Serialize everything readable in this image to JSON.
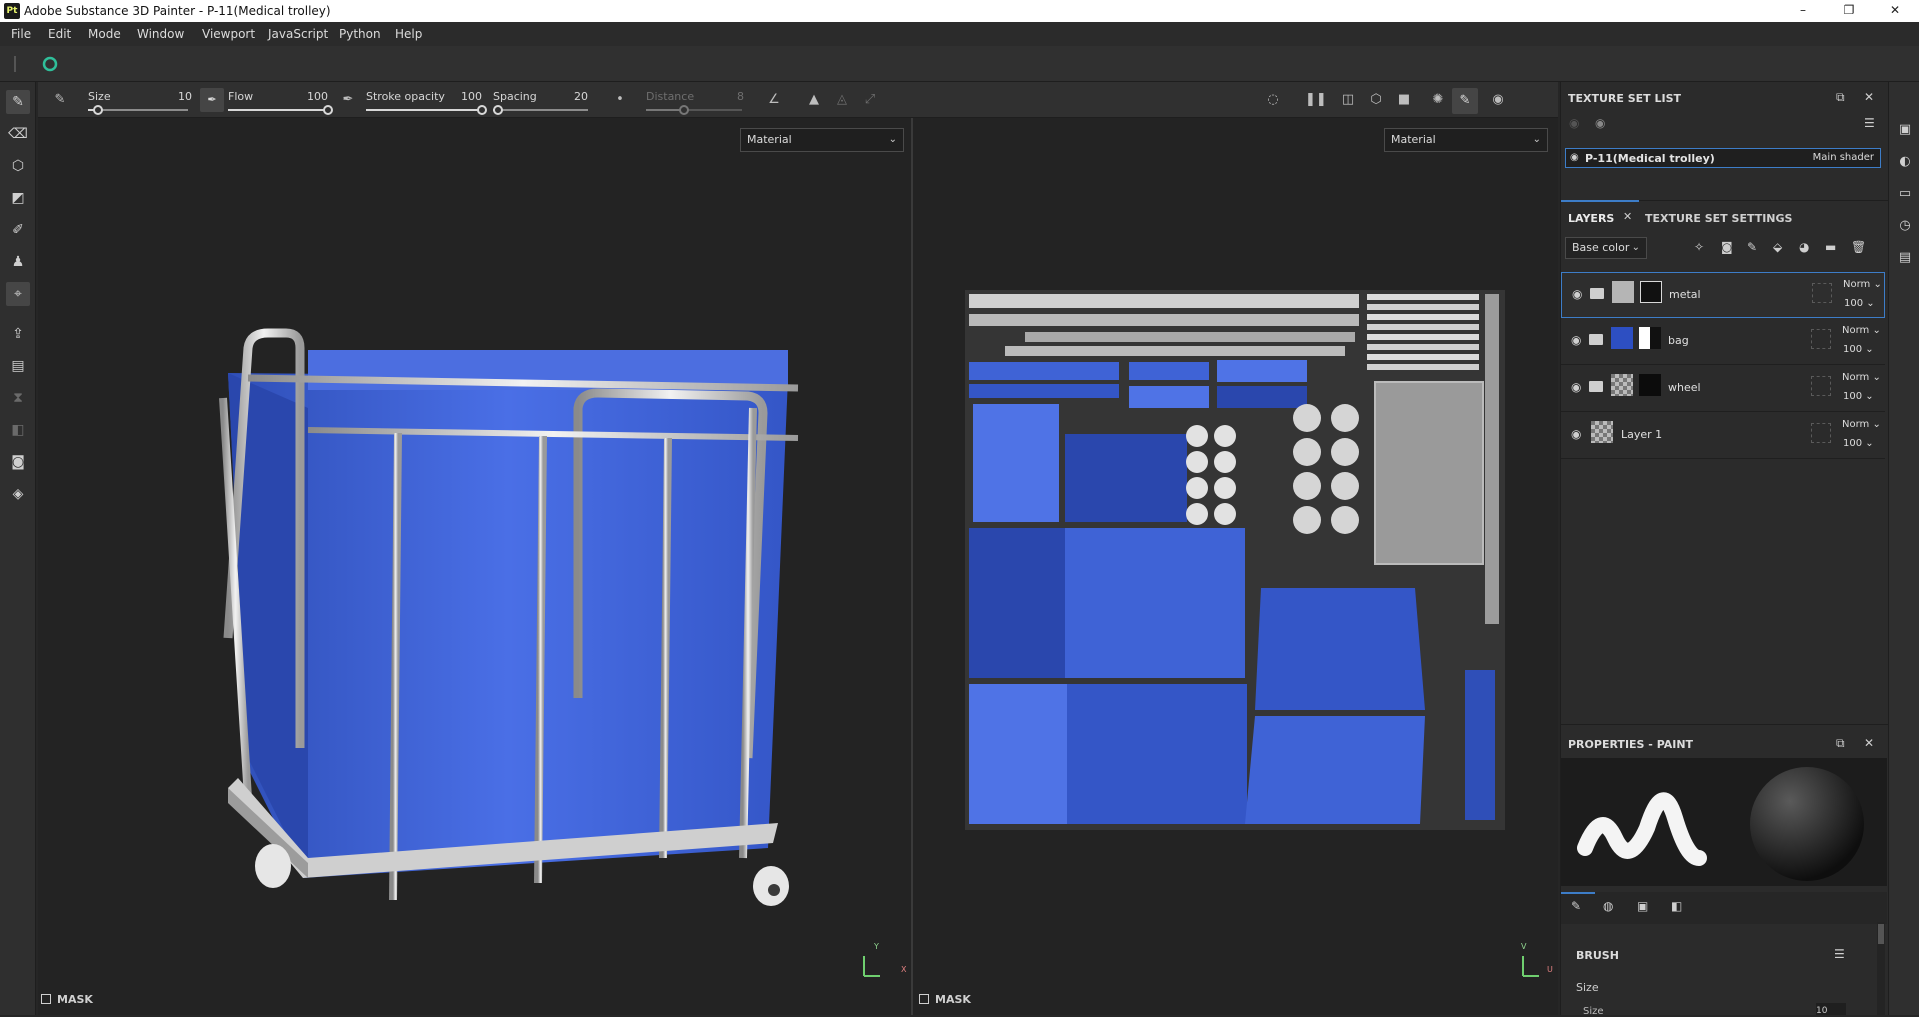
{
  "window": {
    "title": "Adobe Substance 3D Painter - P-11(Medical trolley)",
    "app_badge": "Pt",
    "minimize": "–",
    "maximize": "❐",
    "close": "✕"
  },
  "menu": [
    "File",
    "Edit",
    "Mode",
    "Window",
    "Viewport",
    "JavaScript",
    "Python",
    "Help"
  ],
  "toolbar": {
    "size": {
      "label": "Size",
      "value": "10",
      "fraction": 0.1
    },
    "flow": {
      "label": "Flow",
      "value": "100",
      "fraction": 1.0
    },
    "stroke_opacity": {
      "label": "Stroke opacity",
      "value": "100",
      "fraction": 1.0
    },
    "spacing": {
      "label": "Spacing",
      "value": "20",
      "fraction": 0.05
    },
    "distance": {
      "label": "Distance",
      "value": "8",
      "fraction": 0.4
    }
  },
  "viewport3d": {
    "mode": "Material",
    "mask_label": "MASK",
    "axis_y": "Y",
    "axis_x": "X"
  },
  "viewport2d": {
    "mode": "Material",
    "mask_label": "MASK",
    "axis_v": "V",
    "axis_u": "U"
  },
  "texture_set_list": {
    "title": "TEXTURE SET LIST",
    "item_name": "P-11(Medical trolley)",
    "item_shader": "Main shader"
  },
  "layers_panel": {
    "tab_layers": "LAYERS",
    "tab_settings": "TEXTURE SET SETTINGS",
    "channel": "Base color",
    "layers": [
      {
        "name": "metal",
        "blend": "Norm",
        "opacity": "100",
        "kind": "folder"
      },
      {
        "name": "bag",
        "blend": "Norm",
        "opacity": "100",
        "kind": "folder"
      },
      {
        "name": "wheel",
        "blend": "Norm",
        "opacity": "100",
        "kind": "folder"
      },
      {
        "name": "Layer 1",
        "blend": "Norm",
        "opacity": "100",
        "kind": "layer"
      }
    ]
  },
  "properties": {
    "title": "PROPERTIES - PAINT",
    "section": "BRUSH",
    "size_group": "Size",
    "size_label": "Size",
    "size_value": "10"
  },
  "colors": {
    "accent_blue": "#3d7dc8",
    "cloth_blue": "#3f63d6",
    "panel_bg": "#2b2b2b",
    "viewport_bg": "#232323"
  }
}
